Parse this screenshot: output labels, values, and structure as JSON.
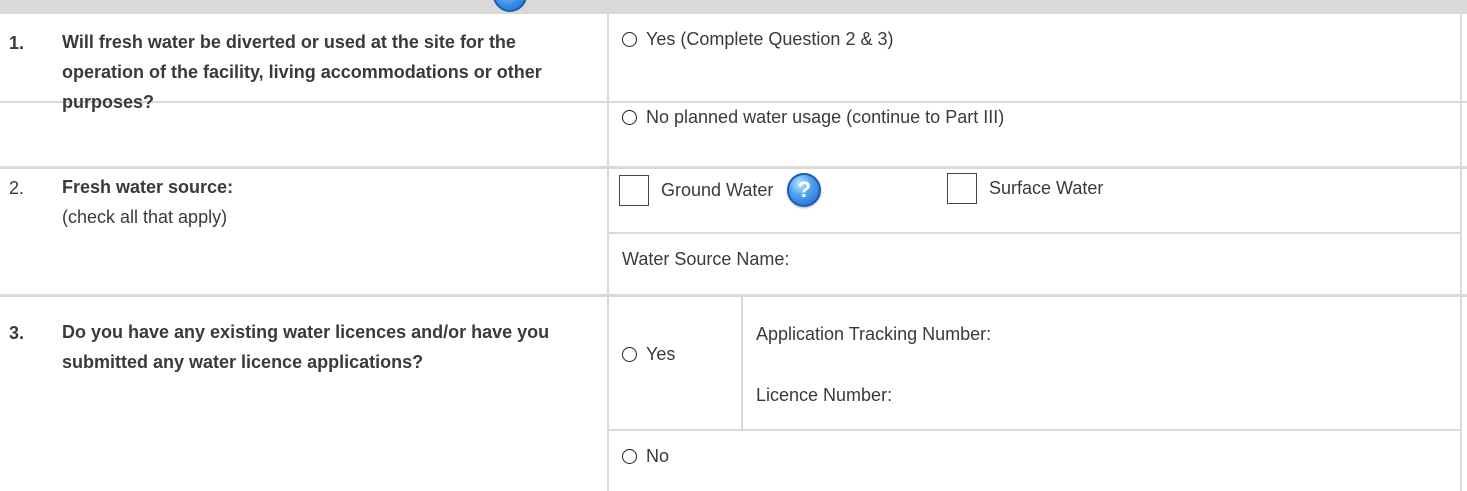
{
  "q1": {
    "number": "1.",
    "text": "Will fresh water be diverted or used at the site for the operation of the facility, living accommodations or other purposes?",
    "options": [
      {
        "label": "Yes (Complete Question 2 & 3)"
      },
      {
        "label": "No planned water usage (continue to Part III)"
      }
    ]
  },
  "q2": {
    "number": "2.",
    "text": "Fresh water source:",
    "subtext": "(check all that apply)",
    "ground_water_label": "Ground Water",
    "surface_water_label": "Surface Water",
    "source_name_label": "Water Source Name:",
    "help_glyph": "?"
  },
  "q3": {
    "number": "3.",
    "text": "Do you have any existing water licences and/or have you submitted any water licence applications?",
    "yes_label": "Yes",
    "no_label": "No",
    "tracking_label": "Application Tracking Number:",
    "licence_label": "Licence Number:"
  }
}
